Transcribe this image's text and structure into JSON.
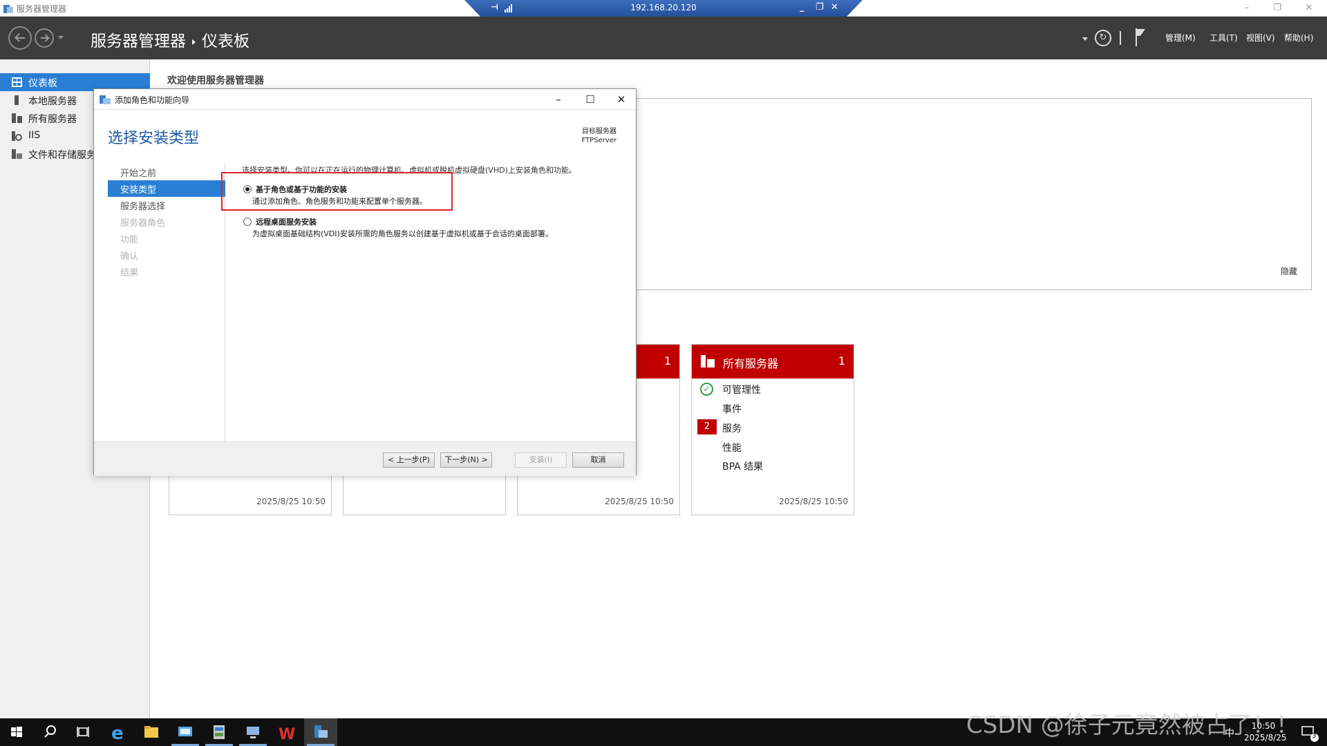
{
  "window": {
    "title": "服务器管理器",
    "controls": {
      "minimize": "–",
      "restore": "❐",
      "close": "✕"
    }
  },
  "rdp": {
    "ip": "192.168.20.120",
    "pin": "⊣",
    "controls": {
      "minimize": "_",
      "restore": "❐",
      "close": "✕"
    }
  },
  "header": {
    "breadcrumb": [
      "服务器管理器",
      "仪表板"
    ],
    "refresh": "↻",
    "menus": [
      "管理(M)",
      "工具(T)",
      "视图(V)",
      "帮助(H)"
    ]
  },
  "sidebar": {
    "items": [
      {
        "label": "仪表板",
        "icon": "dashboard-icon",
        "active": true
      },
      {
        "label": "本地服务器",
        "icon": "server-icon",
        "active": false
      },
      {
        "label": "所有服务器",
        "icon": "servers-icon",
        "active": false
      },
      {
        "label": "IIS",
        "icon": "iis-icon",
        "active": false
      },
      {
        "label": "文件和存储服务",
        "icon": "storage-icon",
        "active": false
      }
    ]
  },
  "main": {
    "welcome": "欢迎使用服务器管理器",
    "hide_link": "隐藏"
  },
  "tiles": {
    "partial_count": "1",
    "all_servers": {
      "title": "所有服务器",
      "count": "1",
      "rows": [
        "可管理性",
        "事件",
        "服务",
        "性能",
        "BPA 结果"
      ],
      "services_badge": "2",
      "ok_icon": "✓"
    },
    "timestamps": [
      "2025/8/25 10:50",
      "2025/8/25 10:50",
      "2025/8/25 10:50"
    ]
  },
  "wizard": {
    "title": "添加角色和功能向导",
    "controls": {
      "minimize": "–",
      "maximize": "☐",
      "close": "✕"
    },
    "heading": "选择安装类型",
    "target_label": "目标服务器",
    "target_server": "FTPServer",
    "steps": [
      {
        "label": "开始之前",
        "state": "done"
      },
      {
        "label": "安装类型",
        "state": "active"
      },
      {
        "label": "服务器选择",
        "state": "done"
      },
      {
        "label": "服务器角色",
        "state": "disabled"
      },
      {
        "label": "功能",
        "state": "disabled"
      },
      {
        "label": "确认",
        "state": "disabled"
      },
      {
        "label": "结果",
        "state": "disabled"
      }
    ],
    "description": "选择安装类型。你可以在正在运行的物理计算机、虚拟机或脱机虚拟硬盘(VHD)上安装角色和功能。",
    "options": [
      {
        "title": "基于角色或基于功能的安装",
        "desc": "通过添加角色、角色服务和功能来配置单个服务器。",
        "checked": true
      },
      {
        "title": "远程桌面服务安装",
        "desc": "为虚拟桌面基础结构(VDI)安装所需的角色服务以创建基于虚拟机或基于会话的桌面部署。",
        "checked": false
      }
    ],
    "buttons": {
      "prev": "< 上一步(P)",
      "next": "下一步(N) >",
      "install": "安装(I)",
      "cancel": "取消"
    }
  },
  "taskbar": {
    "time": "10:50",
    "date": "2025/8/25",
    "notification_count": "3",
    "ime": "中"
  },
  "watermark": "CSDN @徐子元竟然被占了！！"
}
